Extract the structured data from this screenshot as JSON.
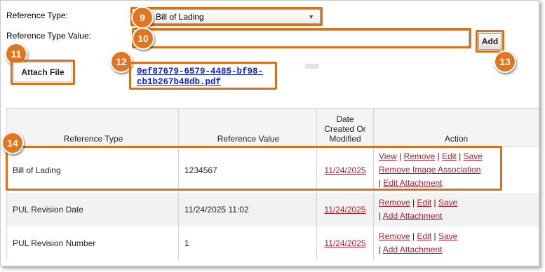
{
  "form": {
    "reference_type_label": "Reference Type:",
    "reference_type_selected": "Bill of Lading",
    "reference_type_value_label": "Reference Type Value:",
    "reference_type_value": "",
    "add_label": "Add",
    "attach_label": "Attach File",
    "file_link": "0ef87679-6579-4485-bf98-cb1b267b48db.pdf"
  },
  "callouts": [
    "9",
    "10",
    "11",
    "12",
    "13",
    "14"
  ],
  "table": {
    "headers": [
      "Reference Type",
      "Reference Value",
      "Date Created Or Modified",
      "Action"
    ],
    "rows": [
      {
        "type": "Bill of Lading",
        "value": "1234567",
        "date": "11/24/2025",
        "actions": [
          "View",
          "Remove",
          "Edit",
          "Save",
          "Remove Image Association",
          "Edit Attachment"
        ]
      },
      {
        "type": "PUL Revision Date",
        "value": "11/24/2025 11:02",
        "date": "11/24/2025",
        "actions": [
          "Remove",
          "Edit",
          "Save",
          "Add Attachment"
        ]
      },
      {
        "type": "PUL Revision Number",
        "value": "1",
        "date": "11/24/2025",
        "actions": [
          "Remove",
          "Edit",
          "Save",
          "Add Attachment"
        ]
      }
    ]
  },
  "colors": {
    "callout": "#e07620",
    "highlight": "#d8711c",
    "link": "#a52230",
    "file_link": "#1122cc"
  }
}
